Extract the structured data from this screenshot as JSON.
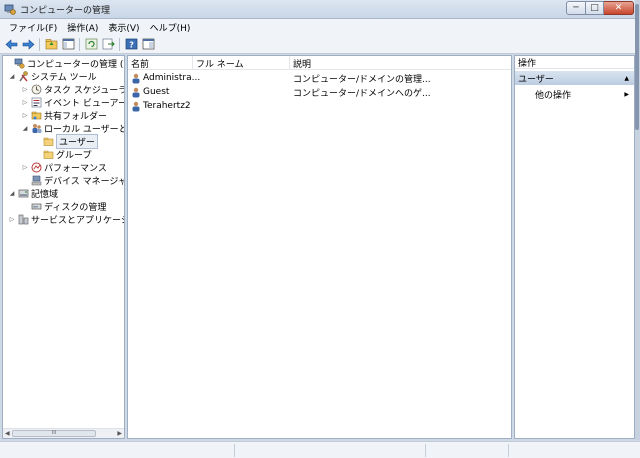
{
  "window": {
    "title": "コンピューターの管理",
    "min_glyph": "─",
    "max_glyph": "□",
    "close_glyph": "✕"
  },
  "menu": [
    "ファイル(F)",
    "操作(A)",
    "表示(V)",
    "ヘルプ(H)"
  ],
  "toolbar": {
    "icons": [
      "back-arrow-icon",
      "forward-arrow-icon",
      "up-folder-icon",
      "show-hide-tree-icon",
      "refresh-icon",
      "export-list-icon",
      "help-icon",
      "properties-icon"
    ]
  },
  "tree": {
    "items": [
      {
        "label": "コンピューターの管理 (ローカ",
        "expander": "",
        "icon": "computer-management-icon"
      },
      {
        "label": "システム ツール",
        "expander": "◢",
        "icon": "system-tools-icon"
      },
      {
        "label": "タスク スケジューラ",
        "expander": "▷",
        "icon": "clock-icon"
      },
      {
        "label": "イベント ビューアー",
        "expander": "▷",
        "icon": "event-viewer-icon"
      },
      {
        "label": "共有フォルダー",
        "expander": "▷",
        "icon": "shared-folder-icon"
      },
      {
        "label": "ローカル ユーザーとグ",
        "expander": "◢",
        "icon": "users-group-icon"
      },
      {
        "label": "ユーザー",
        "expander": "",
        "icon": "folder-icon"
      },
      {
        "label": "グループ",
        "expander": "",
        "icon": "folder-icon"
      },
      {
        "label": "パフォーマンス",
        "expander": "▷",
        "icon": "performance-icon"
      },
      {
        "label": "デバイス マネージャー",
        "expander": "",
        "icon": "device-manager-icon"
      },
      {
        "label": "記憶域",
        "expander": "◢",
        "icon": "storage-icon"
      },
      {
        "label": "ディスクの管理",
        "expander": "",
        "icon": "disk-icon"
      },
      {
        "label": "サービスとアプリケーショ",
        "expander": "▷",
        "icon": "services-icon"
      }
    ],
    "selected_index": 6,
    "scroll_grip": "III",
    "scroll_left": "◀",
    "scroll_right": "▶"
  },
  "list": {
    "columns": [
      "名前",
      "フル ネーム",
      "説明"
    ],
    "rows": [
      {
        "name": "Administra...",
        "full_name": "",
        "description": "コンピューター/ドメインの管理..."
      },
      {
        "name": "Guest",
        "full_name": "",
        "description": "コンピューター/ドメインへのゲ..."
      },
      {
        "name": "Terahertz2",
        "full_name": "",
        "description": ""
      }
    ]
  },
  "actions": {
    "header": "操作",
    "section": "ユーザー",
    "section_arrow": "▲",
    "items": [
      {
        "label": "他の操作",
        "arrow": "▶"
      }
    ]
  },
  "colors": {
    "titlebar": "#c9d6e6",
    "selection": "#e9eef5",
    "actions_section": "#bccde2",
    "folder": "#f5d27a"
  }
}
